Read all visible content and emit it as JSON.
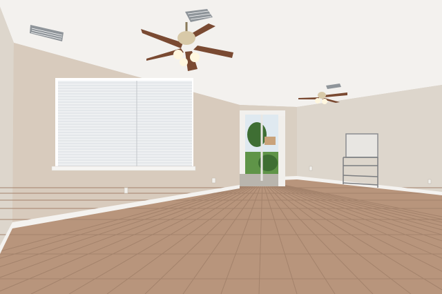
{
  "scene": {
    "colors": {
      "ceiling": "#f3f1ee",
      "wall_left": "#d8cbbd",
      "wall_back": "#d9cfc2",
      "wall_right": "#ddd6cc",
      "baseboard": "#f4f2ef",
      "floor": "#b8957c",
      "floor_grout": "#a3826b",
      "window_blinds": "#eef0f2",
      "fan_blade": "#7a4a32",
      "fan_body": "#d8c9a8",
      "light_glow": "#fff7df",
      "vent": "#8f959a",
      "outdoor_sky": "#dfe9f0",
      "outdoor_grass": "#5f9448",
      "outdoor_tree": "#3e6e33"
    },
    "icons": [
      "ceiling-fan-icon",
      "air-vent-icon",
      "window-blinds-icon",
      "sliding-door-icon",
      "metal-shelf-icon",
      "power-outlet-icon"
    ]
  }
}
